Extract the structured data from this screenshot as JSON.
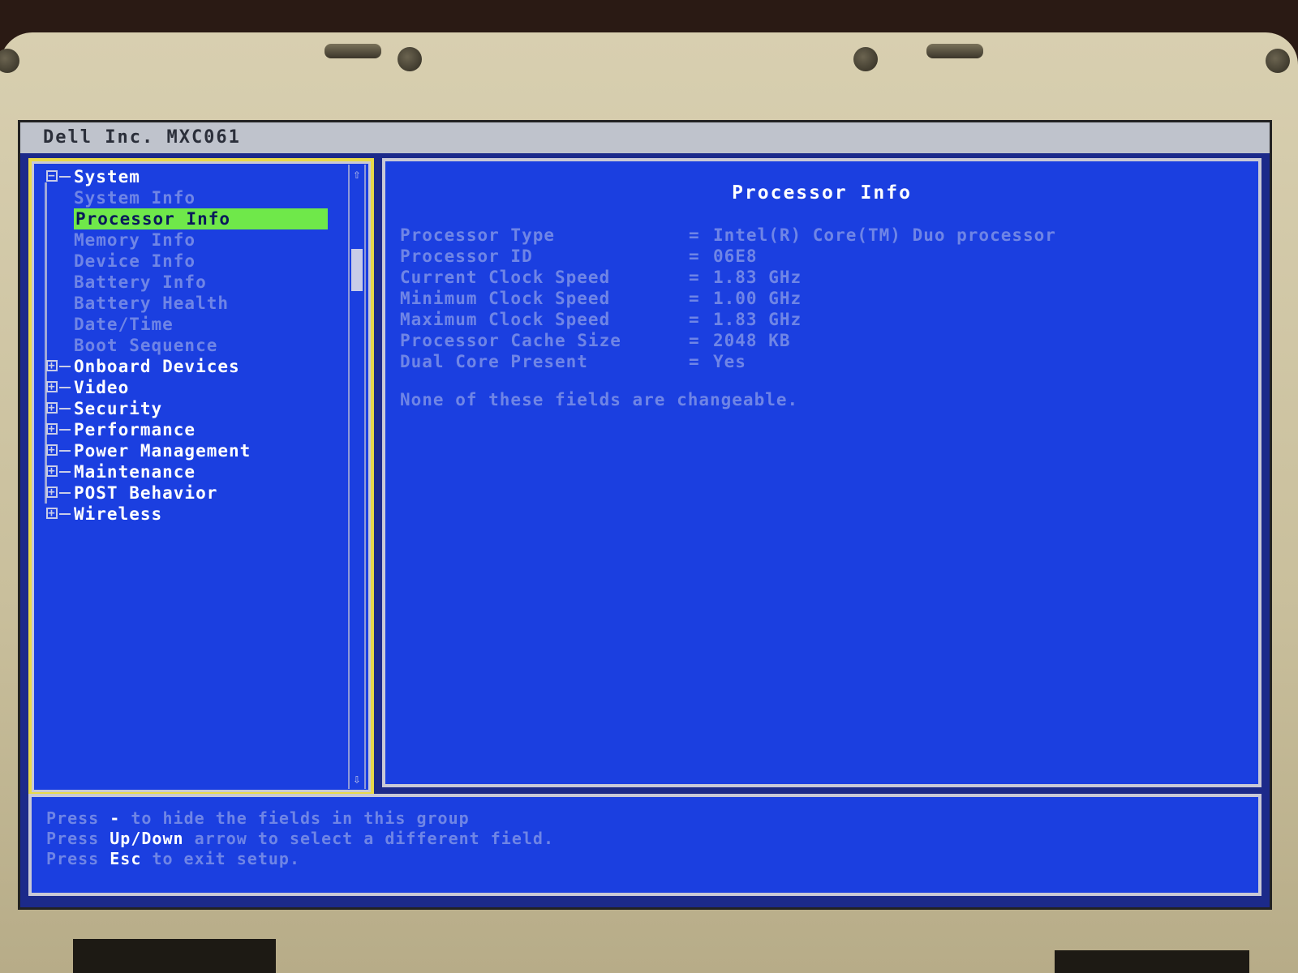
{
  "window": {
    "title": "Dell Inc. MXC061"
  },
  "tree": {
    "items": [
      {
        "label": "System",
        "level": 0,
        "expanded": true
      },
      {
        "label": "System Info",
        "level": 1
      },
      {
        "label": "Processor Info",
        "level": 1,
        "selected": true
      },
      {
        "label": "Memory Info",
        "level": 1
      },
      {
        "label": "Device Info",
        "level": 1
      },
      {
        "label": "Battery Info",
        "level": 1
      },
      {
        "label": "Battery Health",
        "level": 1
      },
      {
        "label": "Date/Time",
        "level": 1
      },
      {
        "label": "Boot Sequence",
        "level": 1
      },
      {
        "label": "Onboard Devices",
        "level": 0,
        "expanded": false
      },
      {
        "label": "Video",
        "level": 0,
        "expanded": false
      },
      {
        "label": "Security",
        "level": 0,
        "expanded": false
      },
      {
        "label": "Performance",
        "level": 0,
        "expanded": false
      },
      {
        "label": "Power Management",
        "level": 0,
        "expanded": false
      },
      {
        "label": "Maintenance",
        "level": 0,
        "expanded": false
      },
      {
        "label": "POST Behavior",
        "level": 0,
        "expanded": false
      },
      {
        "label": "Wireless",
        "level": 0,
        "expanded": false
      }
    ]
  },
  "info": {
    "title": "Processor Info",
    "rows": [
      {
        "key": "Processor Type",
        "value": "Intel(R) Core(TM) Duo processor"
      },
      {
        "key": "Processor ID",
        "value": "06E8"
      },
      {
        "key": "Current Clock Speed",
        "value": "1.83 GHz"
      },
      {
        "key": "Minimum Clock Speed",
        "value": "1.00 GHz"
      },
      {
        "key": "Maximum Clock Speed",
        "value": "1.83 GHz"
      },
      {
        "key": "Processor Cache Size",
        "value": "2048 KB"
      },
      {
        "key": "Dual Core Present",
        "value": "Yes"
      }
    ],
    "note": "None of these fields are changeable."
  },
  "help": {
    "line1": {
      "prefix": "Press",
      "key": "-",
      "suffix": "to hide the fields in this group"
    },
    "line2": {
      "prefix": "Press",
      "key": "Up/Down",
      "suffix": "arrow to select a different field."
    },
    "line3": {
      "prefix": "Press",
      "key": "Esc",
      "suffix": "to exit setup."
    }
  },
  "colors": {
    "screen_bg": "#1b3fe0",
    "selection": "#6fe84a",
    "focus_border": "#e8d94a",
    "text_bright": "#ffffff",
    "text_dim": "#6f85e6"
  }
}
